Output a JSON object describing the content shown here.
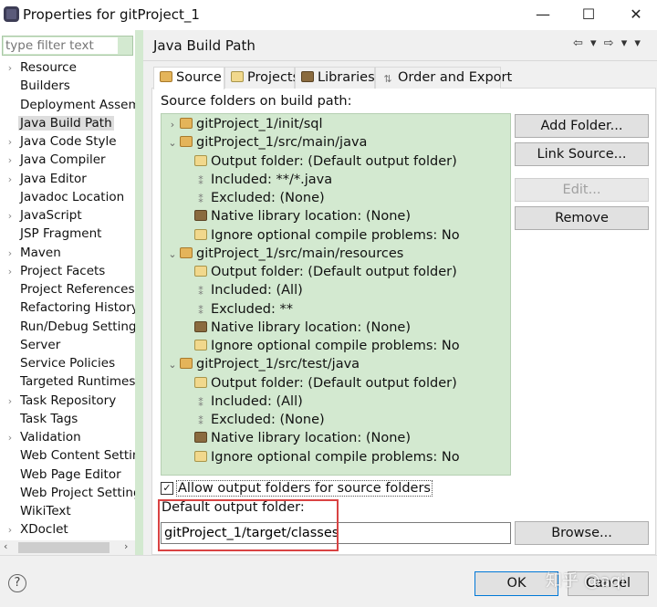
{
  "window": {
    "title": "Properties for gitProject_1",
    "minimize": "—",
    "maximize": "☐",
    "close": "✕"
  },
  "sidebar": {
    "filter_placeholder": "type filter text",
    "items": [
      {
        "label": "Resource",
        "expandable": true
      },
      {
        "label": "Builders",
        "expandable": false
      },
      {
        "label": "Deployment Assem",
        "expandable": false
      },
      {
        "label": "Java Build Path",
        "expandable": false,
        "selected": true
      },
      {
        "label": "Java Code Style",
        "expandable": true
      },
      {
        "label": "Java Compiler",
        "expandable": true
      },
      {
        "label": "Java Editor",
        "expandable": true
      },
      {
        "label": "Javadoc Location",
        "expandable": false
      },
      {
        "label": "JavaScript",
        "expandable": true
      },
      {
        "label": "JSP Fragment",
        "expandable": false
      },
      {
        "label": "Maven",
        "expandable": true
      },
      {
        "label": "Project Facets",
        "expandable": true
      },
      {
        "label": "Project References",
        "expandable": false
      },
      {
        "label": "Refactoring History",
        "expandable": false
      },
      {
        "label": "Run/Debug Settings",
        "expandable": false
      },
      {
        "label": "Server",
        "expandable": false
      },
      {
        "label": "Service Policies",
        "expandable": false
      },
      {
        "label": "Targeted Runtimes",
        "expandable": false
      },
      {
        "label": "Task Repository",
        "expandable": true
      },
      {
        "label": "Task Tags",
        "expandable": false
      },
      {
        "label": "Validation",
        "expandable": true
      },
      {
        "label": "Web Content Settings",
        "expandable": false
      },
      {
        "label": "Web Page Editor",
        "expandable": false
      },
      {
        "label": "Web Project Settings",
        "expandable": false
      },
      {
        "label": "WikiText",
        "expandable": false
      },
      {
        "label": "XDoclet",
        "expandable": true
      }
    ]
  },
  "main": {
    "title": "Java Build Path",
    "nav_arrows": "⇦ ▾ ⇨ ▾ ▾",
    "tabs": [
      {
        "label": "Source",
        "icon": "source-folder-icon",
        "active": true
      },
      {
        "label": "Projects",
        "icon": "projects-icon"
      },
      {
        "label": "Libraries",
        "icon": "libraries-icon"
      },
      {
        "label": "Order and Export",
        "icon": "order-export-icon"
      }
    ],
    "source_label": "Source folders on build path:",
    "tree": [
      {
        "level": 0,
        "toggle": "›",
        "icon": "pkg",
        "text": "gitProject_1/init/sql"
      },
      {
        "level": 0,
        "toggle": "⌄",
        "icon": "pkg",
        "text": "gitProject_1/src/main/java"
      },
      {
        "level": 1,
        "icon": "out",
        "text": "Output folder: (Default output folder)"
      },
      {
        "level": 1,
        "icon": "inc",
        "text": "Included: **/*.java"
      },
      {
        "level": 1,
        "icon": "inc",
        "text": "Excluded: (None)"
      },
      {
        "level": 1,
        "icon": "lib",
        "text": "Native library location: (None)"
      },
      {
        "level": 1,
        "icon": "out",
        "text": "Ignore optional compile problems: No"
      },
      {
        "level": 0,
        "toggle": "⌄",
        "icon": "pkg",
        "text": "gitProject_1/src/main/resources"
      },
      {
        "level": 1,
        "icon": "out",
        "text": "Output folder: (Default output folder)"
      },
      {
        "level": 1,
        "icon": "inc",
        "text": "Included: (All)"
      },
      {
        "level": 1,
        "icon": "inc",
        "text": "Excluded: **"
      },
      {
        "level": 1,
        "icon": "lib",
        "text": "Native library location: (None)"
      },
      {
        "level": 1,
        "icon": "out",
        "text": "Ignore optional compile problems: No"
      },
      {
        "level": 0,
        "toggle": "⌄",
        "icon": "pkg",
        "text": "gitProject_1/src/test/java"
      },
      {
        "level": 1,
        "icon": "out",
        "text": "Output folder: (Default output folder)"
      },
      {
        "level": 1,
        "icon": "inc",
        "text": "Included: (All)"
      },
      {
        "level": 1,
        "icon": "inc",
        "text": "Excluded: (None)"
      },
      {
        "level": 1,
        "icon": "lib",
        "text": "Native library location: (None)"
      },
      {
        "level": 1,
        "icon": "out",
        "text": "Ignore optional compile problems: No"
      }
    ],
    "buttons": {
      "add_folder": "Add Folder...",
      "link_source": "Link Source...",
      "edit": "Edit...",
      "remove": "Remove"
    },
    "allow_output": {
      "label": "Allow output folders for source folders",
      "checked": true
    },
    "default_output_label": "Default output folder:",
    "default_output_value": "gitProject_1/target/classes",
    "browse": "Browse..."
  },
  "footer": {
    "help": "?",
    "ok": "OK",
    "cancel": "Cancel",
    "watermark": "知乎 @aqi"
  },
  "colors": {
    "tree_bg": "#d3e9d0",
    "highlight_box": "#d94343",
    "ok_border": "#0078d7"
  }
}
